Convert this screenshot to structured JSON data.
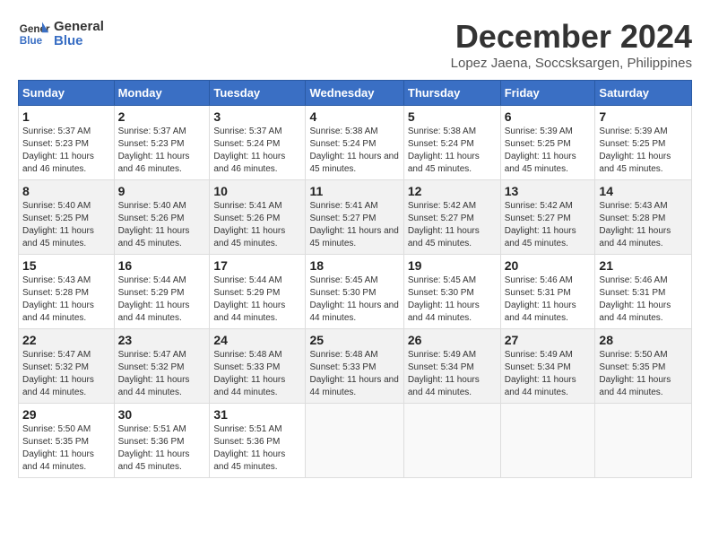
{
  "header": {
    "logo_line1": "General",
    "logo_line2": "Blue",
    "month": "December 2024",
    "location": "Lopez Jaena, Soccsksargen, Philippines"
  },
  "weekdays": [
    "Sunday",
    "Monday",
    "Tuesday",
    "Wednesday",
    "Thursday",
    "Friday",
    "Saturday"
  ],
  "weeks": [
    [
      {
        "day": "1",
        "sunrise": "5:37 AM",
        "sunset": "5:23 PM",
        "daylight": "11 hours and 46 minutes."
      },
      {
        "day": "2",
        "sunrise": "5:37 AM",
        "sunset": "5:23 PM",
        "daylight": "11 hours and 46 minutes."
      },
      {
        "day": "3",
        "sunrise": "5:37 AM",
        "sunset": "5:24 PM",
        "daylight": "11 hours and 46 minutes."
      },
      {
        "day": "4",
        "sunrise": "5:38 AM",
        "sunset": "5:24 PM",
        "daylight": "11 hours and 45 minutes."
      },
      {
        "day": "5",
        "sunrise": "5:38 AM",
        "sunset": "5:24 PM",
        "daylight": "11 hours and 45 minutes."
      },
      {
        "day": "6",
        "sunrise": "5:39 AM",
        "sunset": "5:25 PM",
        "daylight": "11 hours and 45 minutes."
      },
      {
        "day": "7",
        "sunrise": "5:39 AM",
        "sunset": "5:25 PM",
        "daylight": "11 hours and 45 minutes."
      }
    ],
    [
      {
        "day": "8",
        "sunrise": "5:40 AM",
        "sunset": "5:25 PM",
        "daylight": "11 hours and 45 minutes."
      },
      {
        "day": "9",
        "sunrise": "5:40 AM",
        "sunset": "5:26 PM",
        "daylight": "11 hours and 45 minutes."
      },
      {
        "day": "10",
        "sunrise": "5:41 AM",
        "sunset": "5:26 PM",
        "daylight": "11 hours and 45 minutes."
      },
      {
        "day": "11",
        "sunrise": "5:41 AM",
        "sunset": "5:27 PM",
        "daylight": "11 hours and 45 minutes."
      },
      {
        "day": "12",
        "sunrise": "5:42 AM",
        "sunset": "5:27 PM",
        "daylight": "11 hours and 45 minutes."
      },
      {
        "day": "13",
        "sunrise": "5:42 AM",
        "sunset": "5:27 PM",
        "daylight": "11 hours and 45 minutes."
      },
      {
        "day": "14",
        "sunrise": "5:43 AM",
        "sunset": "5:28 PM",
        "daylight": "11 hours and 44 minutes."
      }
    ],
    [
      {
        "day": "15",
        "sunrise": "5:43 AM",
        "sunset": "5:28 PM",
        "daylight": "11 hours and 44 minutes."
      },
      {
        "day": "16",
        "sunrise": "5:44 AM",
        "sunset": "5:29 PM",
        "daylight": "11 hours and 44 minutes."
      },
      {
        "day": "17",
        "sunrise": "5:44 AM",
        "sunset": "5:29 PM",
        "daylight": "11 hours and 44 minutes."
      },
      {
        "day": "18",
        "sunrise": "5:45 AM",
        "sunset": "5:30 PM",
        "daylight": "11 hours and 44 minutes."
      },
      {
        "day": "19",
        "sunrise": "5:45 AM",
        "sunset": "5:30 PM",
        "daylight": "11 hours and 44 minutes."
      },
      {
        "day": "20",
        "sunrise": "5:46 AM",
        "sunset": "5:31 PM",
        "daylight": "11 hours and 44 minutes."
      },
      {
        "day": "21",
        "sunrise": "5:46 AM",
        "sunset": "5:31 PM",
        "daylight": "11 hours and 44 minutes."
      }
    ],
    [
      {
        "day": "22",
        "sunrise": "5:47 AM",
        "sunset": "5:32 PM",
        "daylight": "11 hours and 44 minutes."
      },
      {
        "day": "23",
        "sunrise": "5:47 AM",
        "sunset": "5:32 PM",
        "daylight": "11 hours and 44 minutes."
      },
      {
        "day": "24",
        "sunrise": "5:48 AM",
        "sunset": "5:33 PM",
        "daylight": "11 hours and 44 minutes."
      },
      {
        "day": "25",
        "sunrise": "5:48 AM",
        "sunset": "5:33 PM",
        "daylight": "11 hours and 44 minutes."
      },
      {
        "day": "26",
        "sunrise": "5:49 AM",
        "sunset": "5:34 PM",
        "daylight": "11 hours and 44 minutes."
      },
      {
        "day": "27",
        "sunrise": "5:49 AM",
        "sunset": "5:34 PM",
        "daylight": "11 hours and 44 minutes."
      },
      {
        "day": "28",
        "sunrise": "5:50 AM",
        "sunset": "5:35 PM",
        "daylight": "11 hours and 44 minutes."
      }
    ],
    [
      {
        "day": "29",
        "sunrise": "5:50 AM",
        "sunset": "5:35 PM",
        "daylight": "11 hours and 44 minutes."
      },
      {
        "day": "30",
        "sunrise": "5:51 AM",
        "sunset": "5:36 PM",
        "daylight": "11 hours and 45 minutes."
      },
      {
        "day": "31",
        "sunrise": "5:51 AM",
        "sunset": "5:36 PM",
        "daylight": "11 hours and 45 minutes."
      },
      null,
      null,
      null,
      null
    ]
  ]
}
